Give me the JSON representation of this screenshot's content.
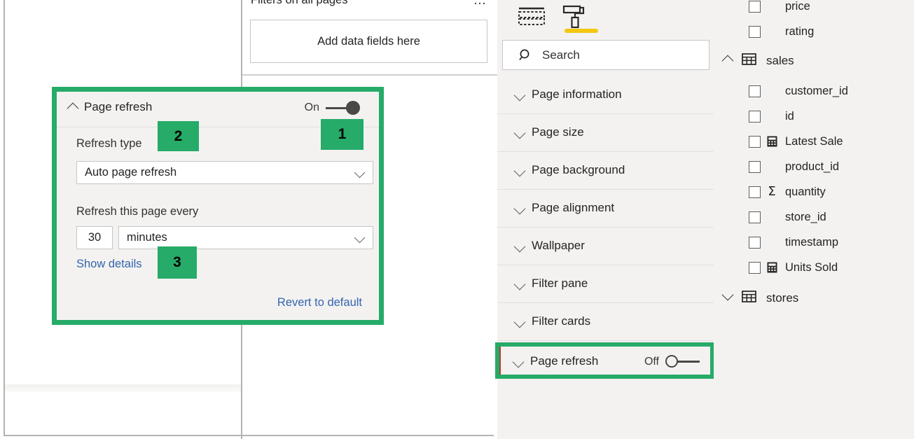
{
  "canvas": {
    "filter_pane": {
      "title": "Filters on all pages",
      "menu_icon": "ellipsis-icon",
      "dropzone_text": "Add data fields here"
    }
  },
  "page_refresh_card": {
    "title": "Page refresh",
    "collapse_icon": "chevron-up-icon",
    "toggle_label": "On",
    "toggle_state": "on",
    "refresh_type_label": "Refresh type",
    "refresh_type_value": "Auto page refresh",
    "refresh_type_options": [
      "Auto page refresh"
    ],
    "interval_label": "Refresh this page every",
    "interval_value": "30",
    "interval_unit": "minutes",
    "interval_unit_options": [
      "minutes"
    ],
    "show_details_link": "Show details",
    "revert_link": "Revert to default"
  },
  "badges": [
    {
      "id": "badge-1",
      "label": "1"
    },
    {
      "id": "badge-2",
      "label": "2"
    },
    {
      "id": "badge-3",
      "label": "3"
    }
  ],
  "format_pane": {
    "tabs": [
      {
        "name": "build-visual-tab",
        "icon": "dashed-table-icon",
        "active": false
      },
      {
        "name": "format-tab",
        "icon": "paint-roller-icon",
        "active": true
      }
    ],
    "search": {
      "placeholder": "Search",
      "value": "",
      "icon": "search-icon"
    },
    "sections": [
      {
        "label": "Page information",
        "icon": "chevron-down-icon"
      },
      {
        "label": "Page size",
        "icon": "chevron-down-icon"
      },
      {
        "label": "Page background",
        "icon": "chevron-down-icon"
      },
      {
        "label": "Page alignment",
        "icon": "chevron-down-icon"
      },
      {
        "label": "Wallpaper",
        "icon": "chevron-down-icon"
      },
      {
        "label": "Filter pane",
        "icon": "chevron-down-icon"
      },
      {
        "label": "Filter cards",
        "icon": "chevron-down-icon"
      }
    ],
    "page_refresh_row": {
      "label": "Page refresh",
      "icon": "chevron-down-icon",
      "toggle_label": "Off",
      "toggle_state": "off"
    }
  },
  "data_pane": {
    "items": [
      {
        "kind": "field",
        "label": "price",
        "icon": null,
        "checked": false
      },
      {
        "kind": "field",
        "label": "rating",
        "icon": null,
        "checked": false
      },
      {
        "kind": "table",
        "label": "sales",
        "icon": "table-icon",
        "expand_icon": "chevron-up-icon",
        "expanded": true
      },
      {
        "kind": "field",
        "label": "customer_id",
        "icon": null,
        "checked": false
      },
      {
        "kind": "field",
        "label": "id",
        "icon": null,
        "checked": false
      },
      {
        "kind": "field",
        "label": "Latest Sale",
        "icon": "measure-icon",
        "checked": false
      },
      {
        "kind": "field",
        "label": "product_id",
        "icon": null,
        "checked": false
      },
      {
        "kind": "field",
        "label": "quantity",
        "icon": "sum-icon",
        "checked": false
      },
      {
        "kind": "field",
        "label": "store_id",
        "icon": null,
        "checked": false
      },
      {
        "kind": "field",
        "label": "timestamp",
        "icon": null,
        "checked": false
      },
      {
        "kind": "field",
        "label": "Units Sold",
        "icon": "measure-icon",
        "checked": false
      },
      {
        "kind": "table",
        "label": "stores",
        "icon": "table-icon",
        "expand_icon": "chevron-down-icon",
        "expanded": false
      }
    ]
  },
  "colors": {
    "highlight_green": "#26ab68",
    "accent_yellow": "#f2c811",
    "link_blue": "#3565ad",
    "pane_background": "#f3f2f1",
    "toggle_grey": "#4a4846"
  }
}
